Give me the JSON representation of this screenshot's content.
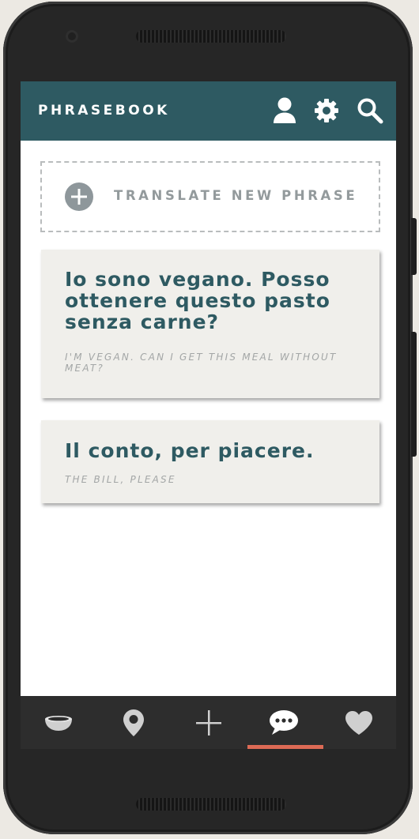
{
  "app": {
    "title": "PHRASEBOOK",
    "header_icons": [
      "profile-icon",
      "settings-gear-icon",
      "search-icon"
    ],
    "accent_color": "#2e5a62",
    "active_indicator_color": "#dc6a55"
  },
  "add_phrase": {
    "label": "TRANSLATE NEW PHRASE",
    "icon": "plus-circle-icon"
  },
  "phrases": [
    {
      "phrase": "Io sono vegano. Posso ottenere questo pasto senza carne?",
      "translation": "I'M VEGAN. CAN I GET THIS MEAL WITHOUT MEAT?"
    },
    {
      "phrase": "Il conto, per piacere.",
      "translation": "THE BILL, PLEASE"
    }
  ],
  "bottom_nav": {
    "items": [
      "food-bowl-icon",
      "location-pin-icon",
      "plus-icon",
      "chat-bubble-icon",
      "heart-icon"
    ],
    "active": "chat-bubble-icon"
  }
}
